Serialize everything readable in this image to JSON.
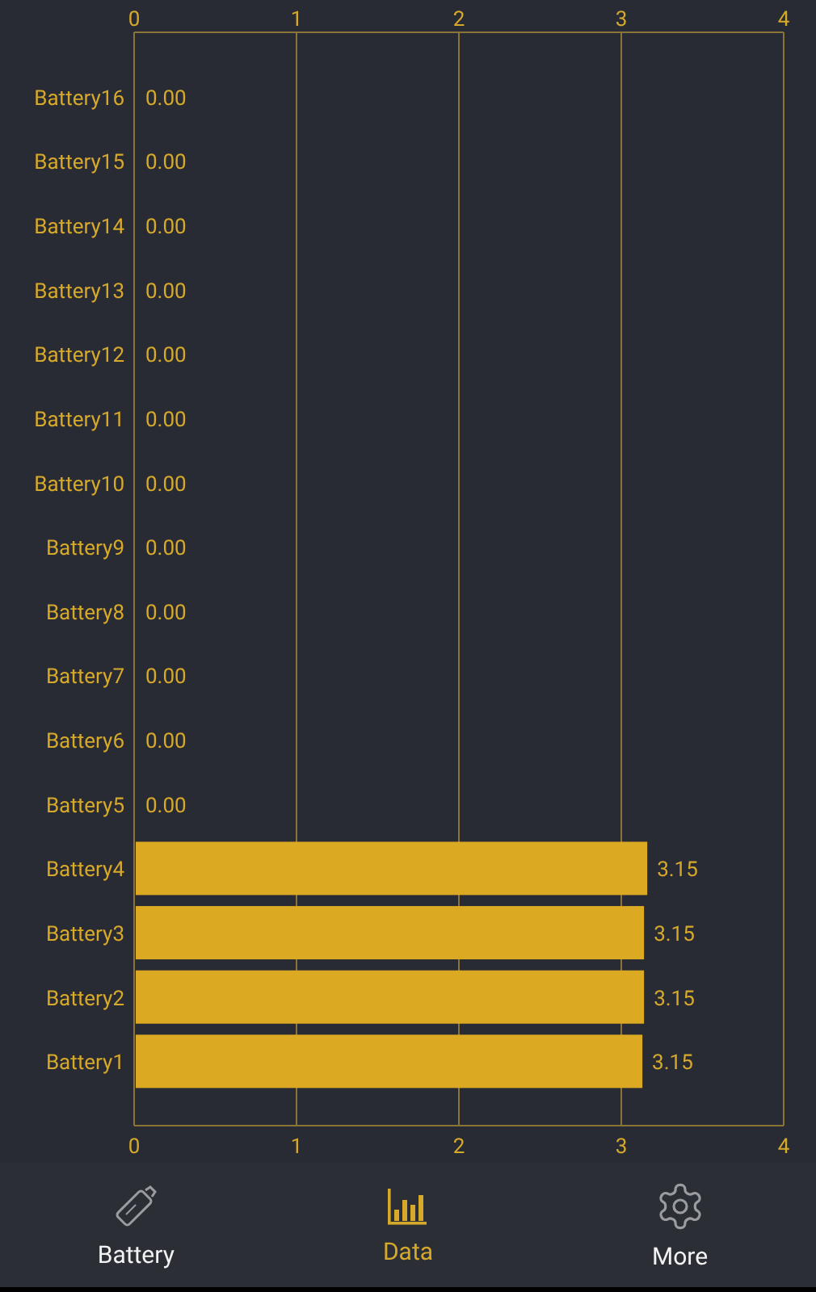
{
  "chart": {
    "bottom_axis_labels": [
      "0",
      "1",
      "2",
      "3",
      "4"
    ],
    "chart_data": {
      "type": "bar",
      "orientation": "horizontal",
      "grid": true,
      "categories": [
        "Battery16",
        "Battery15",
        "Battery14",
        "Battery13",
        "Battery12",
        "Battery11",
        "Battery10",
        "Battery9",
        "Battery8",
        "Battery7",
        "Battery6",
        "Battery5",
        "Battery4",
        "Battery3",
        "Battery2",
        "Battery1"
      ],
      "series": [
        {
          "color": "#dca923",
          "values": [
            0,
            0,
            0,
            0,
            0,
            0,
            0,
            0,
            0,
            0,
            0,
            0,
            3.15,
            3.13,
            3.13,
            3.12
          ]
        }
      ],
      "value_labels": [
        "0.00",
        "0.00",
        "0.00",
        "0.00",
        "0.00",
        "0.00",
        "0.00",
        "0.00",
        "0.00",
        "0.00",
        "0.00",
        "0.00",
        "3.15",
        "3.15",
        "3.15",
        "3.15"
      ],
      "xlim": [
        0,
        4
      ],
      "xticks": [
        0,
        1,
        2,
        3,
        4
      ]
    }
  },
  "tab_bar": {
    "items": [
      {
        "kind": "battery",
        "label": "Battery",
        "selected": false
      },
      {
        "kind": "data",
        "label": "Data",
        "selected": true
      },
      {
        "kind": "more",
        "label": "More",
        "selected": false
      }
    ]
  }
}
